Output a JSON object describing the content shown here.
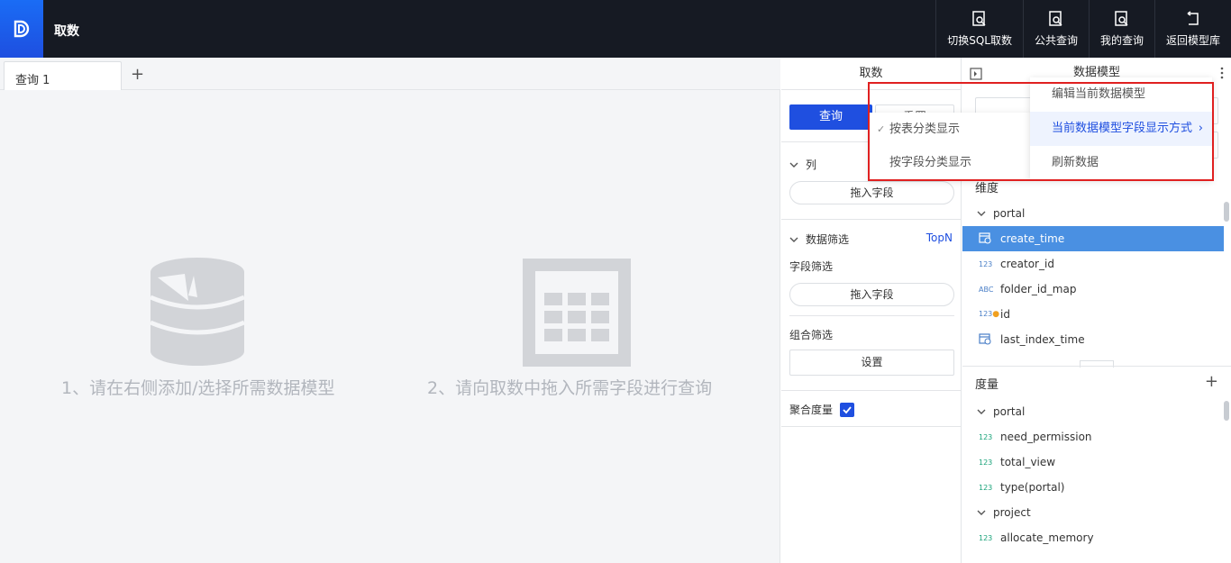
{
  "app": {
    "title": "取数"
  },
  "top_actions": [
    {
      "label": "切换SQL取数",
      "icon": "sql-switch-icon"
    },
    {
      "label": "公共查询",
      "icon": "public-query-icon"
    },
    {
      "label": "我的查询",
      "icon": "my-query-icon"
    },
    {
      "label": "返回模型库",
      "icon": "return-icon"
    }
  ],
  "tabs": [
    {
      "label": "查询 1"
    }
  ],
  "canvas": {
    "hint1": "1、请在右侧添加/选择所需数据模型",
    "hint2": "2、请向取数中拖入所需字段进行查询"
  },
  "mid": {
    "title": "取数",
    "query_button": "查询",
    "reset_button": "重置",
    "columns_label": "列",
    "drop_field": "拖入字段",
    "filter_label": "数据筛选",
    "topn": "TopN",
    "field_filter": "字段筛选",
    "combo_filter": "组合筛选",
    "set_button": "设置",
    "agg_label": "聚合度量"
  },
  "right": {
    "title": "数据模型",
    "dimension_label": "维度",
    "measure_label": "度量",
    "dimension_groups": [
      {
        "name": "portal",
        "fields": [
          {
            "name": "create_time",
            "type": "date",
            "selected": true
          },
          {
            "name": "creator_id",
            "type": "num"
          },
          {
            "name": "folder_id_map",
            "type": "abc"
          },
          {
            "name": "id",
            "type": "num-key"
          },
          {
            "name": "last_index_time",
            "type": "date"
          }
        ]
      }
    ],
    "measure_groups": [
      {
        "name": "portal",
        "fields": [
          {
            "name": "need_permission"
          },
          {
            "name": "total_view"
          },
          {
            "name": "type(portal)"
          }
        ]
      },
      {
        "name": "project",
        "fields": [
          {
            "name": "allocate_memory"
          }
        ]
      }
    ]
  },
  "menu": {
    "items": [
      {
        "label": "编辑当前数据模型"
      },
      {
        "label": "当前数据模型字段显示方式",
        "active": true
      },
      {
        "label": "刷新数据"
      }
    ],
    "submenu": [
      {
        "label": "按表分类显示",
        "checked": true
      },
      {
        "label": "按字段分类显示"
      }
    ]
  },
  "type_labels": {
    "num": "123",
    "abc": "ABC"
  }
}
